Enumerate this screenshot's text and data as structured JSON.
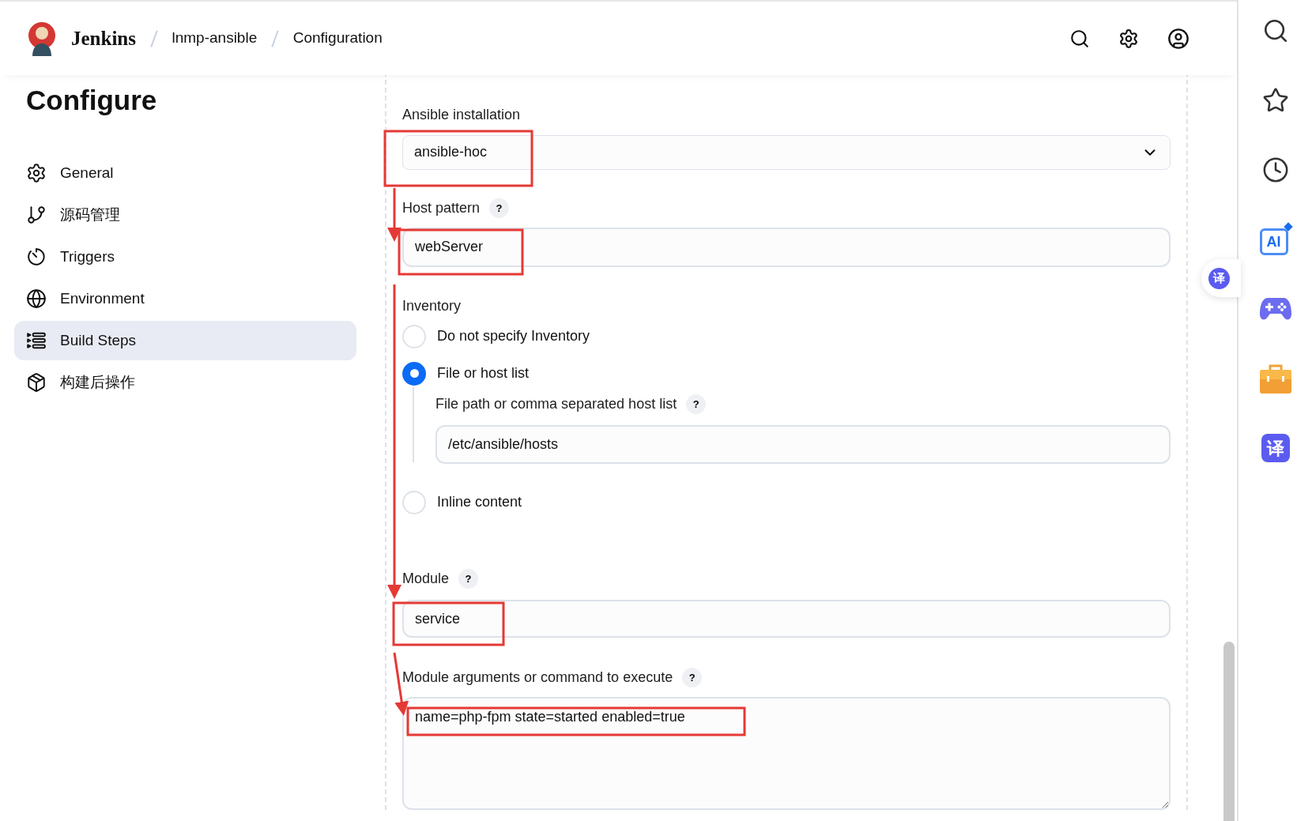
{
  "header": {
    "brand": "Jenkins",
    "breadcrumbs": [
      "lnmp-ansible",
      "Configuration"
    ]
  },
  "sidebar": {
    "title": "Configure",
    "items": [
      {
        "label": "General",
        "kind": "gear",
        "selected": false
      },
      {
        "label": "源码管理",
        "kind": "branch",
        "selected": false
      },
      {
        "label": "Triggers",
        "kind": "timer",
        "selected": false
      },
      {
        "label": "Environment",
        "kind": "globe",
        "selected": false
      },
      {
        "label": "Build Steps",
        "kind": "steps",
        "selected": true
      },
      {
        "label": "构建后操作",
        "kind": "package",
        "selected": false
      }
    ]
  },
  "section": {
    "ansible_installation": {
      "label": "Ansible installation",
      "value": "ansible-hoc"
    },
    "host_pattern": {
      "label": "Host pattern",
      "help": "?",
      "value": "webServer"
    },
    "inventory": {
      "label": "Inventory",
      "options": [
        {
          "label": "Do not specify Inventory",
          "selected": false
        },
        {
          "label": "File or host list",
          "selected": true,
          "field": {
            "label": "File path or comma separated host list",
            "help": "?",
            "value": "/etc/ansible/hosts"
          }
        },
        {
          "label": "Inline content",
          "selected": false
        }
      ]
    },
    "module": {
      "label": "Module",
      "help": "?",
      "value": "service"
    },
    "module_arguments": {
      "label": "Module arguments or command to execute",
      "help": "?",
      "value": "name=php-fpm state=started enabled=true"
    }
  },
  "floating_button": {
    "text": "译"
  },
  "right_rail": [
    {
      "kind": "search"
    },
    {
      "kind": "star"
    },
    {
      "kind": "clock"
    },
    {
      "kind": "ai",
      "text": "AI"
    },
    {
      "kind": "gamepad"
    },
    {
      "kind": "briefcase"
    },
    {
      "kind": "translate",
      "text": "译"
    }
  ]
}
